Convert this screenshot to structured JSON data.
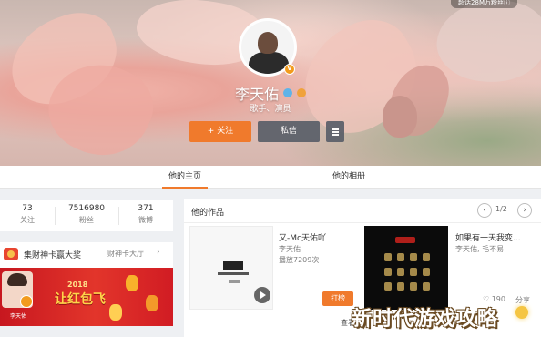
{
  "cover": {
    "top_chip": "超话28M万粉丝ⓘ",
    "name": "李天佑",
    "subtitle": "歌手、演员"
  },
  "actions": {
    "follow": "+ 关注",
    "message": "私信"
  },
  "tabs": [
    {
      "label": "他的主页",
      "active": true
    },
    {
      "label": "他的相册",
      "active": false
    }
  ],
  "stats": [
    {
      "value": "73",
      "label": "关注"
    },
    {
      "value": "7516980",
      "label": "粉丝"
    },
    {
      "value": "371",
      "label": "微博"
    }
  ],
  "promo": {
    "title": "集财神卡赢大奖",
    "link": "财神卡大厅",
    "chevron": "›",
    "banner_year": "2018",
    "banner_text": "让红包飞",
    "banner_name": "李天佑"
  },
  "works": {
    "title": "他的作品",
    "pager": {
      "prev": "‹",
      "text": "1/2",
      "next": "›"
    },
    "items": [
      {
        "title": "又-Mc天佑吖",
        "artist": "李天佑",
        "plays": "播放7209次",
        "action": "打榜"
      },
      {
        "title": "如果有一天我变...",
        "artist": "李天佑, 毛不易",
        "likes": "190",
        "share": "分享"
      }
    ],
    "more": "查看更多"
  },
  "watermark": "新时代游戏攻略",
  "colors": {
    "accent": "#f07a2c",
    "secondary_button": "#5a5f69",
    "promo_red": "#d11c23",
    "verified_badge": "#f29b1d"
  },
  "icons": [
    "verified-icon",
    "weibo-level-icon",
    "menu-icon",
    "money-icon",
    "play-icon",
    "like-icon",
    "chevron-left-icon",
    "chevron-right-icon"
  ]
}
